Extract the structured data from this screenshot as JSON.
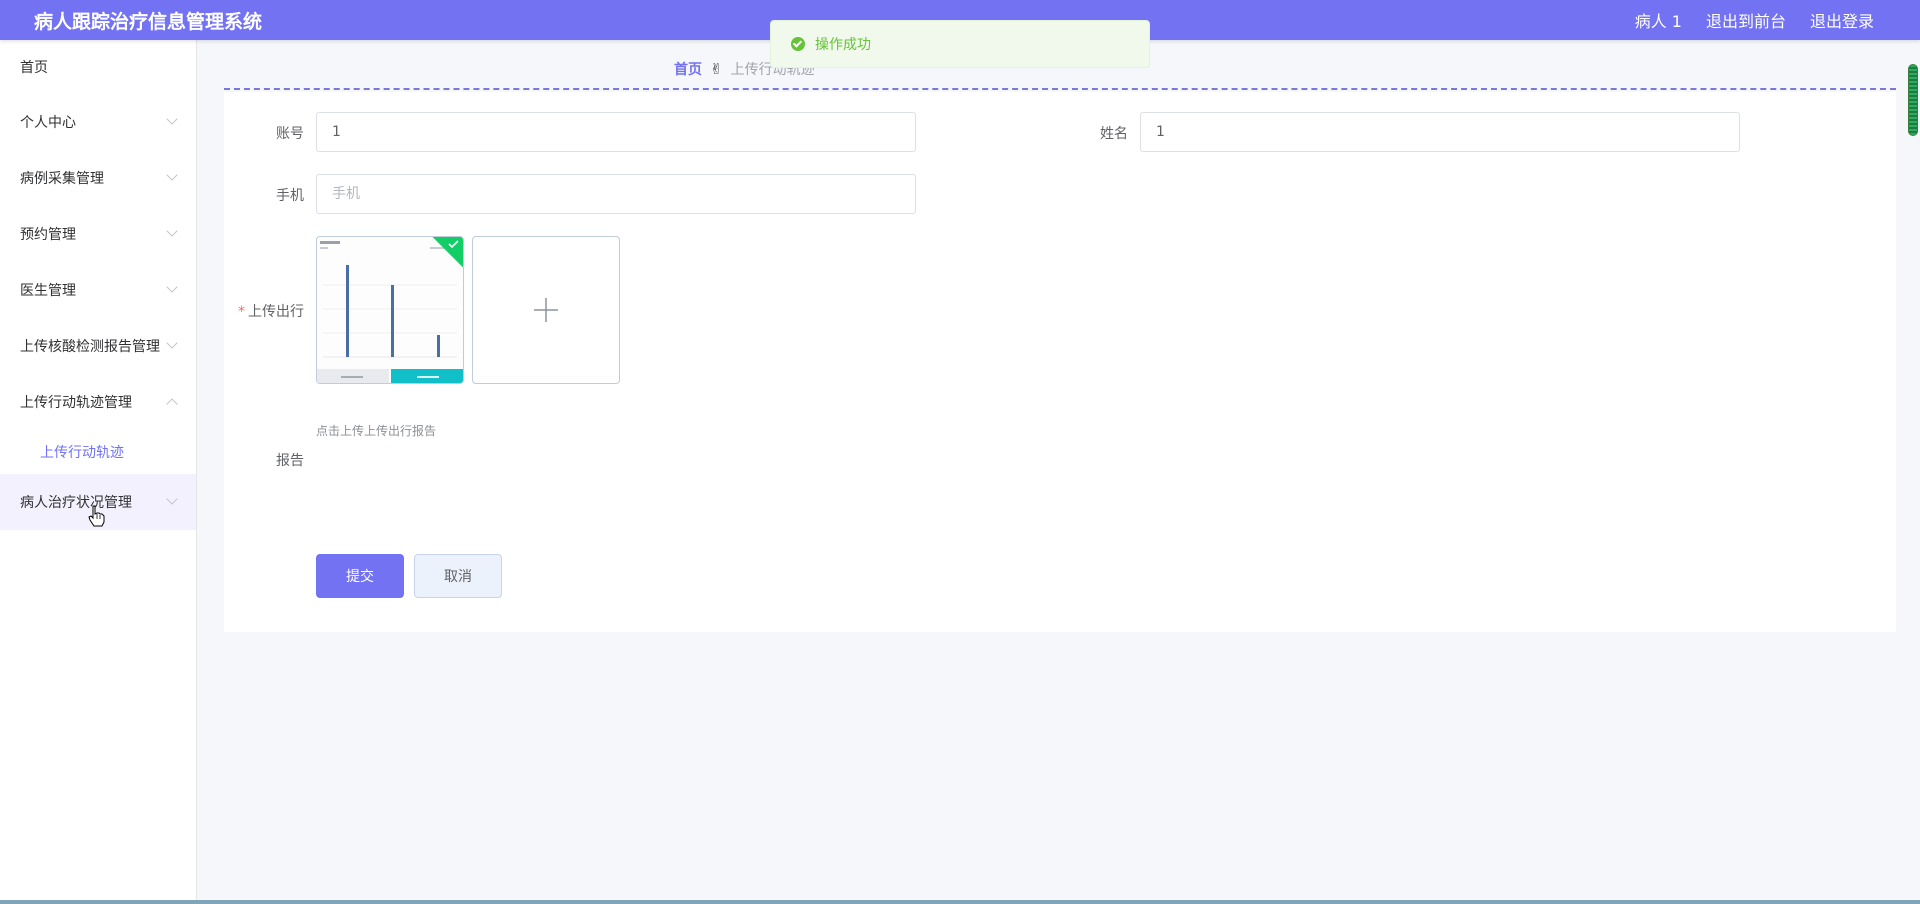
{
  "header": {
    "title": "病人跟踪治疗信息管理系统",
    "user_label": "病人 1",
    "front_link": "退出到前台",
    "logout_link": "退出登录"
  },
  "sidebar": {
    "items": [
      {
        "label": "首页"
      },
      {
        "label": "个人中心"
      },
      {
        "label": "病例采集管理"
      },
      {
        "label": "预约管理"
      },
      {
        "label": "医生管理"
      },
      {
        "label": "上传核酸检测报告管理"
      },
      {
        "label": "上传行动轨迹管理"
      },
      {
        "label": "病人治疗状况管理"
      }
    ],
    "sub_item": "上传行动轨迹"
  },
  "breadcrumb": {
    "home": "首页",
    "separator": "✌",
    "current": "上传行动轨迹"
  },
  "toast": {
    "message": "操作成功"
  },
  "form": {
    "account_label": "账号",
    "account_value": "1",
    "name_label": "姓名",
    "name_value": "1",
    "phone_label": "手机",
    "phone_placeholder": "手机",
    "upload_label": "上传出行",
    "report_label": "报告",
    "upload_tip": "点击上传上传出行报告",
    "submit_label": "提交",
    "cancel_label": "取消"
  },
  "colors": {
    "accent": "#7272f3",
    "success": "#67c23a",
    "badge": "#13ce66"
  }
}
